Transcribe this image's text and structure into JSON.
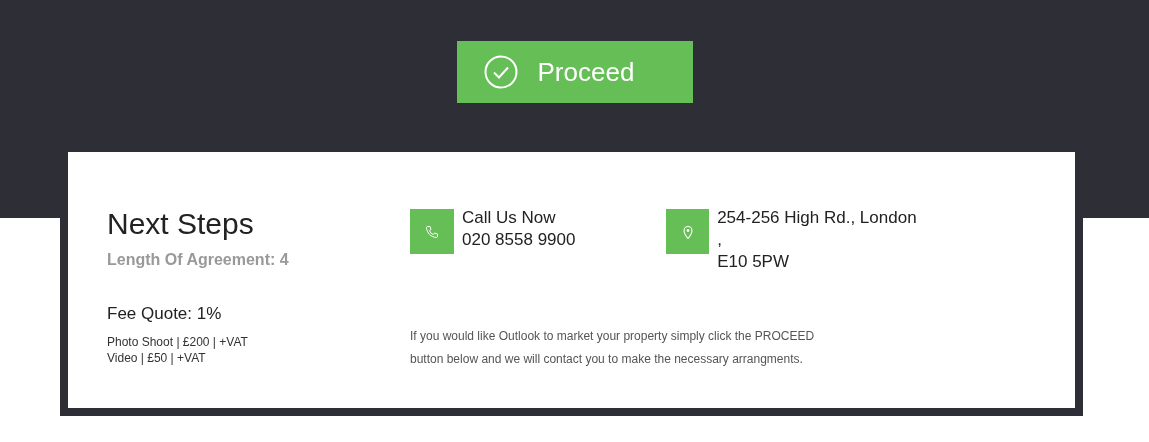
{
  "proceed_button": {
    "label": "Proceed"
  },
  "next_steps": {
    "title": "Next Steps",
    "agreement": "Length Of Agreement: 4",
    "fee_quote": "Fee Quote: 1%",
    "extras": [
      "Photo Shoot | £200 | +VAT",
      "Video | £50 | +VAT"
    ]
  },
  "contacts": [
    {
      "kind": "phone",
      "lines": [
        "Call Us Now",
        "020 8558 9900"
      ]
    },
    {
      "kind": "location",
      "lines": [
        "254-256 High Rd., London ,",
        "E10 5PW"
      ]
    }
  ],
  "message": "If you would like Outlook to market your property simply click the PROCEED button below and we will contact you to make the necessary arrangments."
}
